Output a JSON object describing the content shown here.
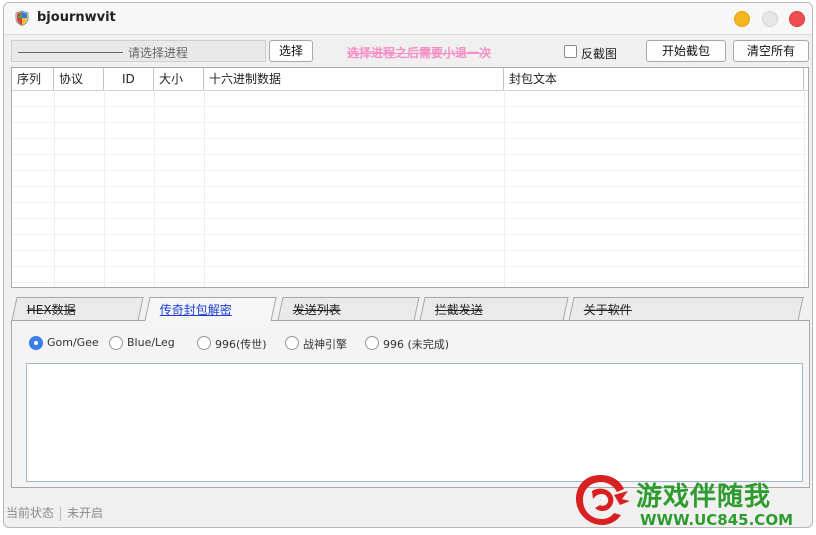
{
  "window": {
    "title": "bjournwvit"
  },
  "toolbar": {
    "process_placeholder": "请选择进程",
    "select_label": "选择",
    "hint_text": "选择进程之后需要小退一次",
    "checkbox_label": "反截图",
    "start_label": "开始截包",
    "clear_label": "清空所有"
  },
  "packet_table": {
    "columns": [
      "序列",
      "协议",
      "ID",
      "大小",
      "十六进制数据",
      "封包文本"
    ],
    "rows": []
  },
  "tabs": [
    {
      "label": "HEX数据",
      "active": false
    },
    {
      "label": "传奇封包解密",
      "active": true
    },
    {
      "label": "发送列表",
      "active": false
    },
    {
      "label": "拦截发送",
      "active": false
    },
    {
      "label": "关于软件",
      "active": false
    }
  ],
  "decrypt_panel": {
    "options": [
      {
        "label": "Gom/Gee",
        "selected": true
      },
      {
        "label": "Blue/Leg",
        "selected": false
      },
      {
        "label": "996(传世)",
        "selected": false
      },
      {
        "label": "战神引擎",
        "selected": false
      },
      {
        "label": "996 (未完成)",
        "selected": false
      }
    ],
    "output_text": ""
  },
  "status_bar": {
    "label": "当前状态",
    "value": "未开启"
  },
  "watermark": {
    "name": "游戏伴随我",
    "url": "WWW.UC845.COM"
  },
  "colors": {
    "accent": "#3b7de9",
    "hint": "#f48fc6",
    "watermark": "#2e9b2e"
  }
}
